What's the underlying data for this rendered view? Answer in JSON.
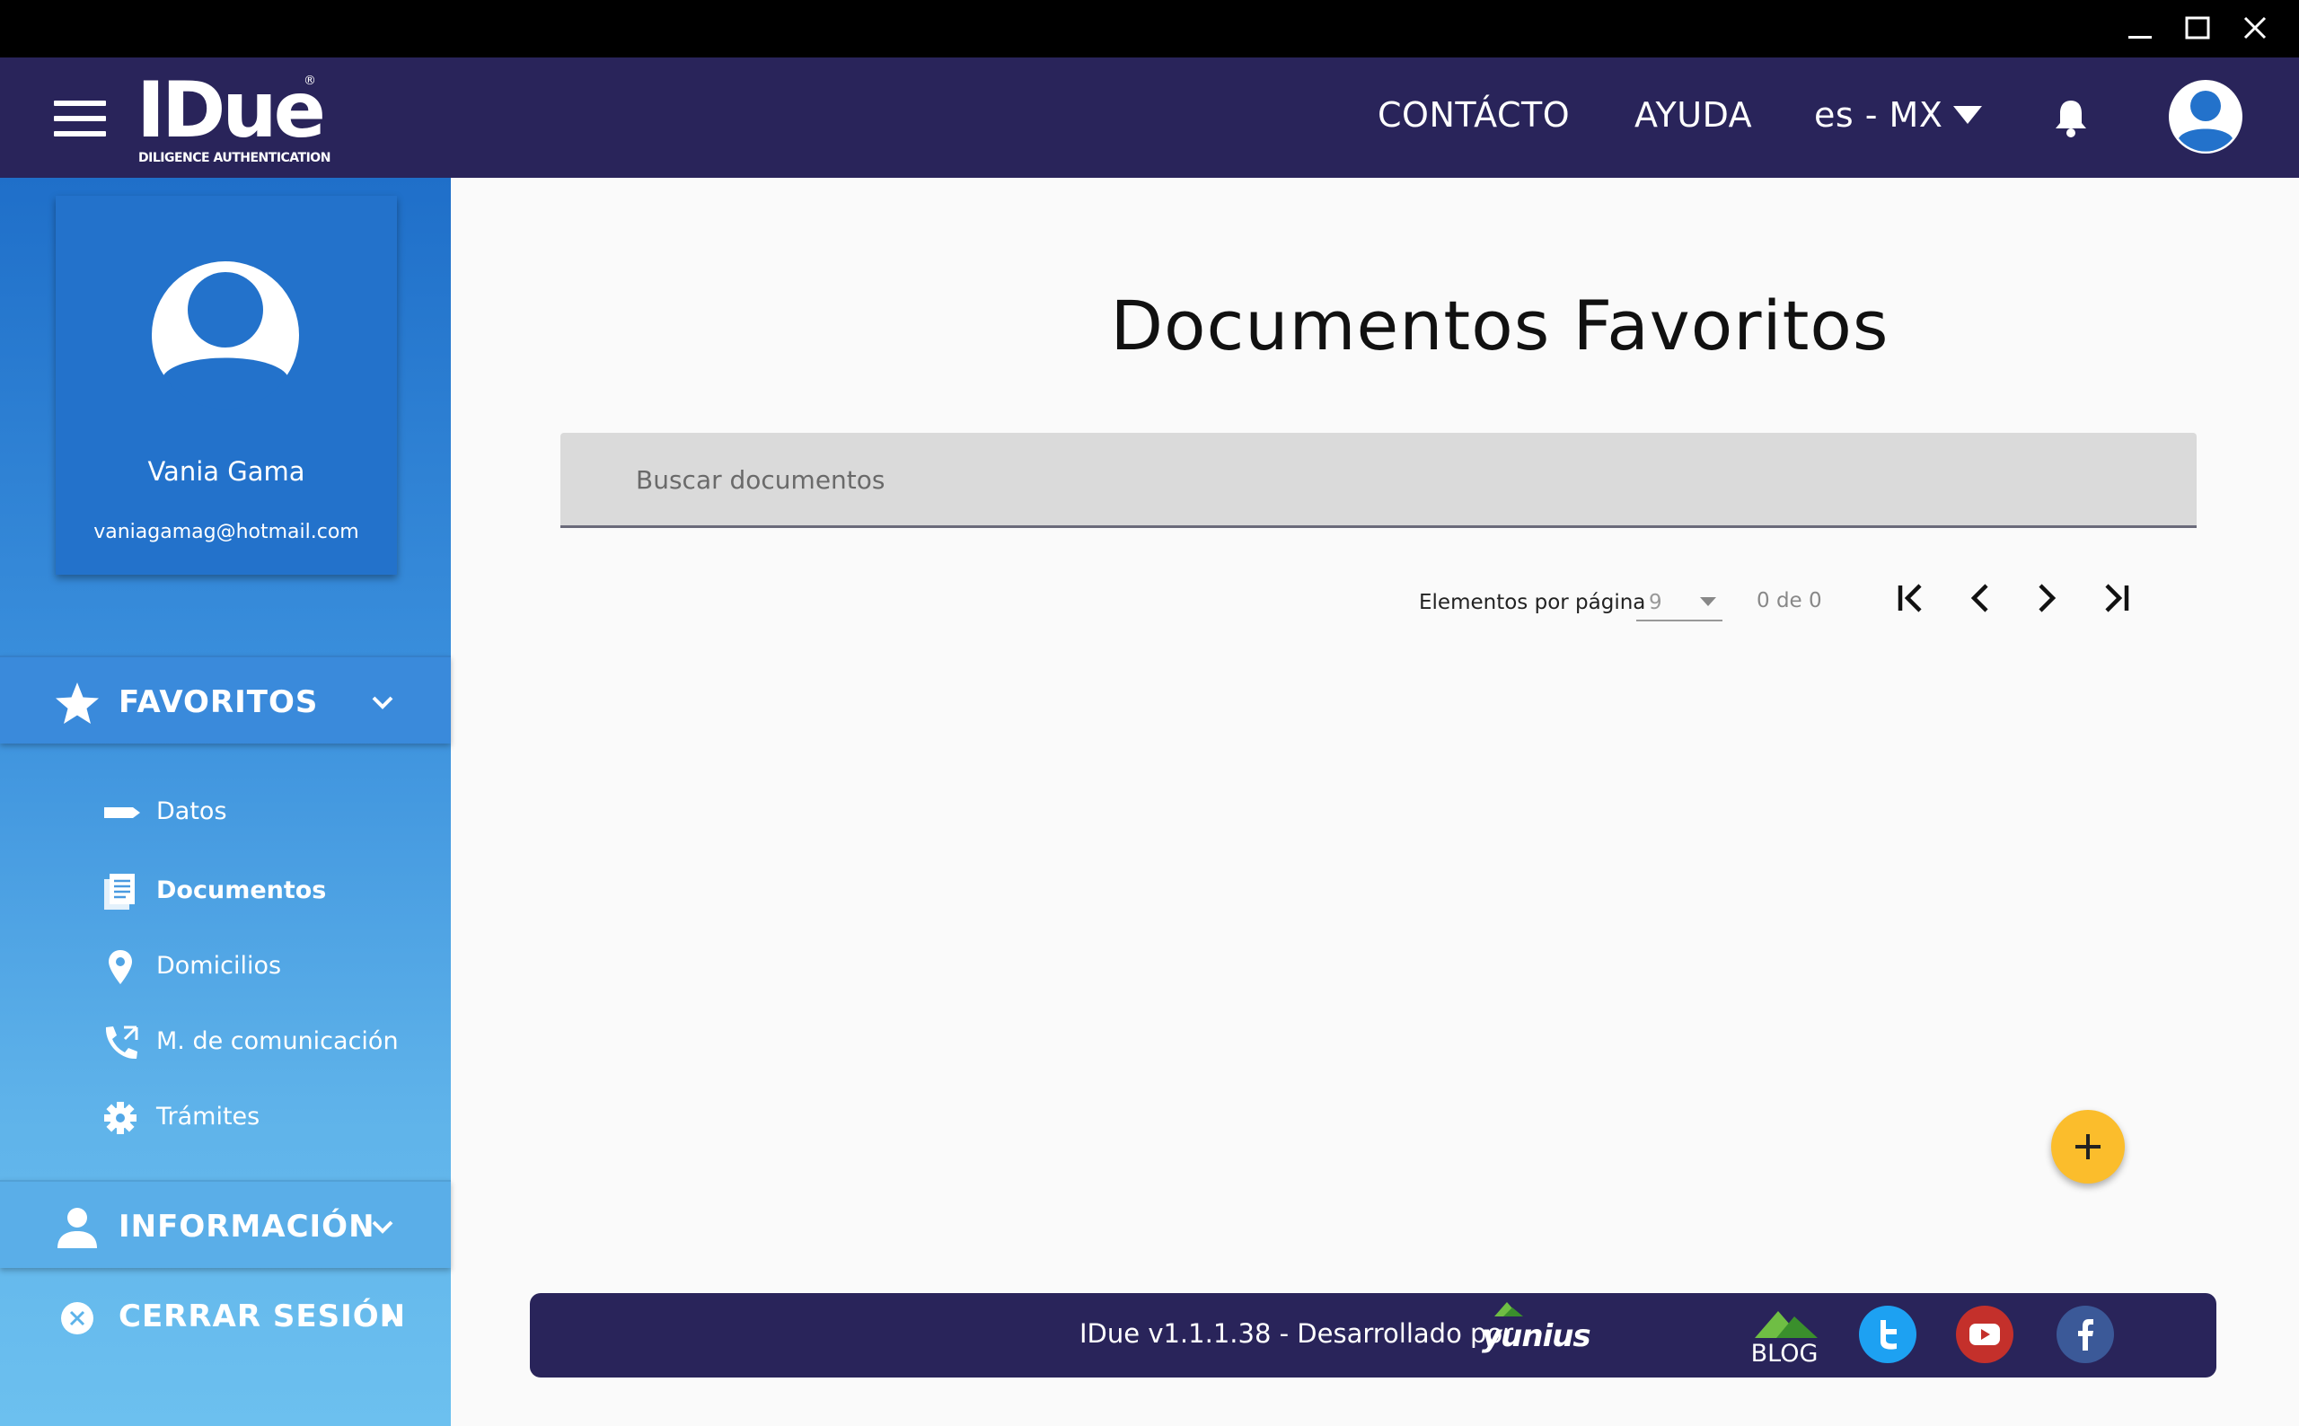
{
  "header": {
    "logo_text": "IDue",
    "logo_subtitle": "DILIGENCE AUTHENTICATION",
    "logo_reg": "®",
    "nav_contacto": "CONTÁCTO",
    "nav_ayuda": "AYUDA",
    "language": "es - MX"
  },
  "profile": {
    "name": "Vania Gama",
    "email": "vaniagamag@hotmail.com"
  },
  "sidebar": {
    "favoritos_label": "FAVORITOS",
    "items": [
      {
        "label": "Datos",
        "icon": "label-icon",
        "active": false
      },
      {
        "label": "Documentos",
        "icon": "document-icon",
        "active": true
      },
      {
        "label": "Domicilios",
        "icon": "location-pin-icon",
        "active": false
      },
      {
        "label": "M. de comunicación",
        "icon": "phone-icon",
        "active": false
      },
      {
        "label": "Trámites",
        "icon": "gear-icon",
        "active": false
      }
    ],
    "informacion_label": "INFORMACIÓN",
    "logout_label": "CERRAR SESIÓN"
  },
  "main": {
    "title": "Documentos Favoritos",
    "search_placeholder": "Buscar documentos",
    "pager": {
      "label": "Elementos por página",
      "page_size": "9",
      "range": "0 de 0"
    }
  },
  "footer": {
    "text": "IDue v1.1.1.38 - Desarrollado por",
    "brand": "yunius",
    "blog": "BLOG"
  },
  "colors": {
    "header_bg": "#29245a",
    "sidebar_top": "#1f6fc9",
    "sidebar_bottom": "#6cc0ef",
    "fab": "#fbbd2c"
  }
}
